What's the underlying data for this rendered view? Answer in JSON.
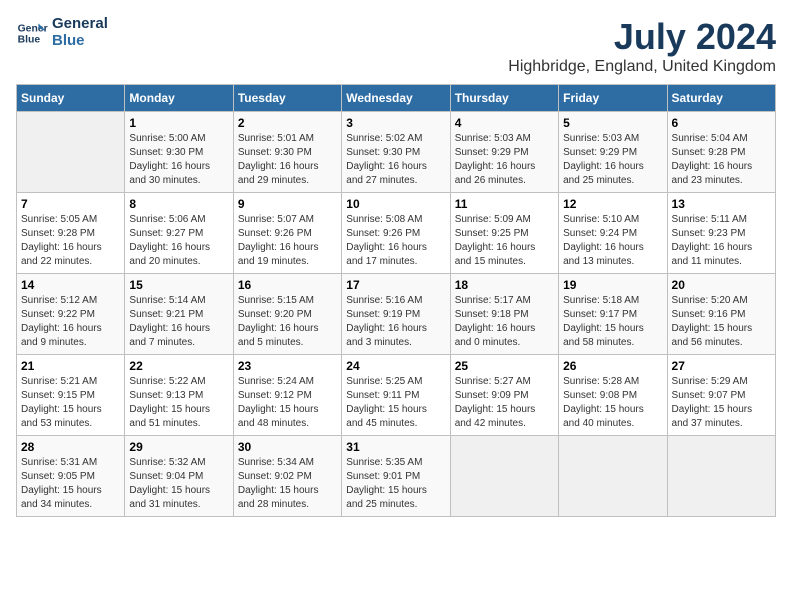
{
  "logo": {
    "line1": "General",
    "line2": "Blue"
  },
  "title": {
    "month_year": "July 2024",
    "location": "Highbridge, England, United Kingdom"
  },
  "days_of_week": [
    "Sunday",
    "Monday",
    "Tuesday",
    "Wednesday",
    "Thursday",
    "Friday",
    "Saturday"
  ],
  "weeks": [
    [
      {
        "day": "",
        "sunrise": "",
        "sunset": "",
        "daylight": ""
      },
      {
        "day": "1",
        "sunrise": "Sunrise: 5:00 AM",
        "sunset": "Sunset: 9:30 PM",
        "daylight": "Daylight: 16 hours and 30 minutes."
      },
      {
        "day": "2",
        "sunrise": "Sunrise: 5:01 AM",
        "sunset": "Sunset: 9:30 PM",
        "daylight": "Daylight: 16 hours and 29 minutes."
      },
      {
        "day": "3",
        "sunrise": "Sunrise: 5:02 AM",
        "sunset": "Sunset: 9:30 PM",
        "daylight": "Daylight: 16 hours and 27 minutes."
      },
      {
        "day": "4",
        "sunrise": "Sunrise: 5:03 AM",
        "sunset": "Sunset: 9:29 PM",
        "daylight": "Daylight: 16 hours and 26 minutes."
      },
      {
        "day": "5",
        "sunrise": "Sunrise: 5:03 AM",
        "sunset": "Sunset: 9:29 PM",
        "daylight": "Daylight: 16 hours and 25 minutes."
      },
      {
        "day": "6",
        "sunrise": "Sunrise: 5:04 AM",
        "sunset": "Sunset: 9:28 PM",
        "daylight": "Daylight: 16 hours and 23 minutes."
      }
    ],
    [
      {
        "day": "7",
        "sunrise": "Sunrise: 5:05 AM",
        "sunset": "Sunset: 9:28 PM",
        "daylight": "Daylight: 16 hours and 22 minutes."
      },
      {
        "day": "8",
        "sunrise": "Sunrise: 5:06 AM",
        "sunset": "Sunset: 9:27 PM",
        "daylight": "Daylight: 16 hours and 20 minutes."
      },
      {
        "day": "9",
        "sunrise": "Sunrise: 5:07 AM",
        "sunset": "Sunset: 9:26 PM",
        "daylight": "Daylight: 16 hours and 19 minutes."
      },
      {
        "day": "10",
        "sunrise": "Sunrise: 5:08 AM",
        "sunset": "Sunset: 9:26 PM",
        "daylight": "Daylight: 16 hours and 17 minutes."
      },
      {
        "day": "11",
        "sunrise": "Sunrise: 5:09 AM",
        "sunset": "Sunset: 9:25 PM",
        "daylight": "Daylight: 16 hours and 15 minutes."
      },
      {
        "day": "12",
        "sunrise": "Sunrise: 5:10 AM",
        "sunset": "Sunset: 9:24 PM",
        "daylight": "Daylight: 16 hours and 13 minutes."
      },
      {
        "day": "13",
        "sunrise": "Sunrise: 5:11 AM",
        "sunset": "Sunset: 9:23 PM",
        "daylight": "Daylight: 16 hours and 11 minutes."
      }
    ],
    [
      {
        "day": "14",
        "sunrise": "Sunrise: 5:12 AM",
        "sunset": "Sunset: 9:22 PM",
        "daylight": "Daylight: 16 hours and 9 minutes."
      },
      {
        "day": "15",
        "sunrise": "Sunrise: 5:14 AM",
        "sunset": "Sunset: 9:21 PM",
        "daylight": "Daylight: 16 hours and 7 minutes."
      },
      {
        "day": "16",
        "sunrise": "Sunrise: 5:15 AM",
        "sunset": "Sunset: 9:20 PM",
        "daylight": "Daylight: 16 hours and 5 minutes."
      },
      {
        "day": "17",
        "sunrise": "Sunrise: 5:16 AM",
        "sunset": "Sunset: 9:19 PM",
        "daylight": "Daylight: 16 hours and 3 minutes."
      },
      {
        "day": "18",
        "sunrise": "Sunrise: 5:17 AM",
        "sunset": "Sunset: 9:18 PM",
        "daylight": "Daylight: 16 hours and 0 minutes."
      },
      {
        "day": "19",
        "sunrise": "Sunrise: 5:18 AM",
        "sunset": "Sunset: 9:17 PM",
        "daylight": "Daylight: 15 hours and 58 minutes."
      },
      {
        "day": "20",
        "sunrise": "Sunrise: 5:20 AM",
        "sunset": "Sunset: 9:16 PM",
        "daylight": "Daylight: 15 hours and 56 minutes."
      }
    ],
    [
      {
        "day": "21",
        "sunrise": "Sunrise: 5:21 AM",
        "sunset": "Sunset: 9:15 PM",
        "daylight": "Daylight: 15 hours and 53 minutes."
      },
      {
        "day": "22",
        "sunrise": "Sunrise: 5:22 AM",
        "sunset": "Sunset: 9:13 PM",
        "daylight": "Daylight: 15 hours and 51 minutes."
      },
      {
        "day": "23",
        "sunrise": "Sunrise: 5:24 AM",
        "sunset": "Sunset: 9:12 PM",
        "daylight": "Daylight: 15 hours and 48 minutes."
      },
      {
        "day": "24",
        "sunrise": "Sunrise: 5:25 AM",
        "sunset": "Sunset: 9:11 PM",
        "daylight": "Daylight: 15 hours and 45 minutes."
      },
      {
        "day": "25",
        "sunrise": "Sunrise: 5:27 AM",
        "sunset": "Sunset: 9:09 PM",
        "daylight": "Daylight: 15 hours and 42 minutes."
      },
      {
        "day": "26",
        "sunrise": "Sunrise: 5:28 AM",
        "sunset": "Sunset: 9:08 PM",
        "daylight": "Daylight: 15 hours and 40 minutes."
      },
      {
        "day": "27",
        "sunrise": "Sunrise: 5:29 AM",
        "sunset": "Sunset: 9:07 PM",
        "daylight": "Daylight: 15 hours and 37 minutes."
      }
    ],
    [
      {
        "day": "28",
        "sunrise": "Sunrise: 5:31 AM",
        "sunset": "Sunset: 9:05 PM",
        "daylight": "Daylight: 15 hours and 34 minutes."
      },
      {
        "day": "29",
        "sunrise": "Sunrise: 5:32 AM",
        "sunset": "Sunset: 9:04 PM",
        "daylight": "Daylight: 15 hours and 31 minutes."
      },
      {
        "day": "30",
        "sunrise": "Sunrise: 5:34 AM",
        "sunset": "Sunset: 9:02 PM",
        "daylight": "Daylight: 15 hours and 28 minutes."
      },
      {
        "day": "31",
        "sunrise": "Sunrise: 5:35 AM",
        "sunset": "Sunset: 9:01 PM",
        "daylight": "Daylight: 15 hours and 25 minutes."
      },
      {
        "day": "",
        "sunrise": "",
        "sunset": "",
        "daylight": ""
      },
      {
        "day": "",
        "sunrise": "",
        "sunset": "",
        "daylight": ""
      },
      {
        "day": "",
        "sunrise": "",
        "sunset": "",
        "daylight": ""
      }
    ]
  ]
}
